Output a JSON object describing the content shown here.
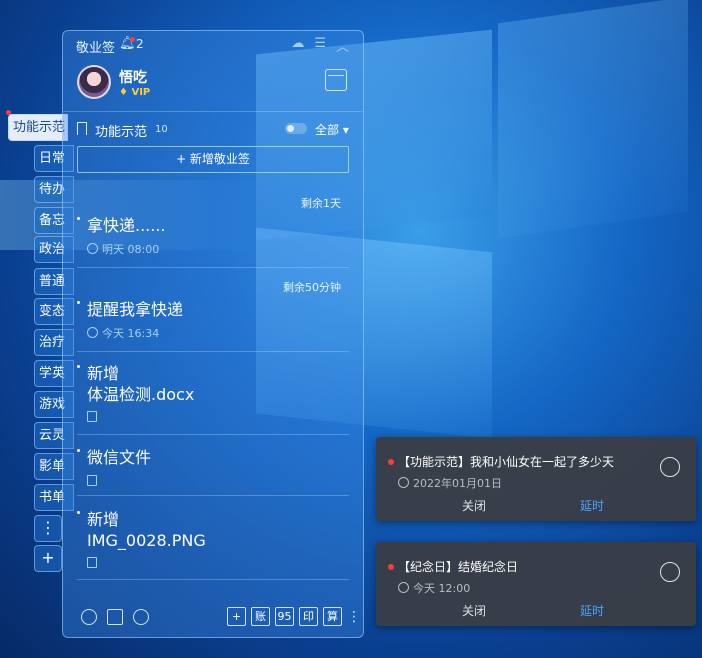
{
  "app": {
    "name": "敬业签",
    "notification_count": "2"
  },
  "user": {
    "name": "悟吃",
    "badge": "VIP"
  },
  "sidebar": {
    "tabs": [
      {
        "label": "功能示范",
        "active": true
      },
      {
        "label": "日常"
      },
      {
        "label": "待办"
      },
      {
        "label": "备忘"
      },
      {
        "label": "政治"
      },
      {
        "label": "普通"
      },
      {
        "label": "变态"
      },
      {
        "label": "治疗"
      },
      {
        "label": "学英"
      },
      {
        "label": "游戏"
      },
      {
        "label": "云灵"
      },
      {
        "label": "影单"
      },
      {
        "label": "书单"
      }
    ],
    "more_label": "⋮",
    "add_label": "+"
  },
  "category": {
    "title": "功能示范",
    "count": "10",
    "filter_label": "全部"
  },
  "add_button_label": "+ 新增敬业签",
  "notes": [
    {
      "remaining": "剩余1天",
      "title": "拿快递......",
      "meta": "明天 08:00"
    },
    {
      "remaining": "剩余50分钟",
      "title": "提醒我拿快递",
      "meta": "今天 16:34"
    },
    {
      "title_line1": "新增",
      "title_line2": "体温检测.docx"
    },
    {
      "title": "微信文件"
    },
    {
      "title_line1": "新增",
      "title_line2": "IMG_0028.PNG"
    }
  ],
  "bottom_keys": [
    "+",
    "账",
    "95",
    "印",
    "算"
  ],
  "toasts": [
    {
      "title": "【功能示范】我和小仙女在一起了多少天",
      "meta": "2022年01月01日",
      "close": "关闭",
      "delay": "延时"
    },
    {
      "title": "【纪念日】结婚纪念日",
      "meta": "今天  12:00",
      "close": "关闭",
      "delay": "延时"
    }
  ],
  "colors": {
    "accent_red": "#ff3b3b",
    "delay_blue": "#4ba3ff",
    "vip_gold": "#ffcc33"
  }
}
